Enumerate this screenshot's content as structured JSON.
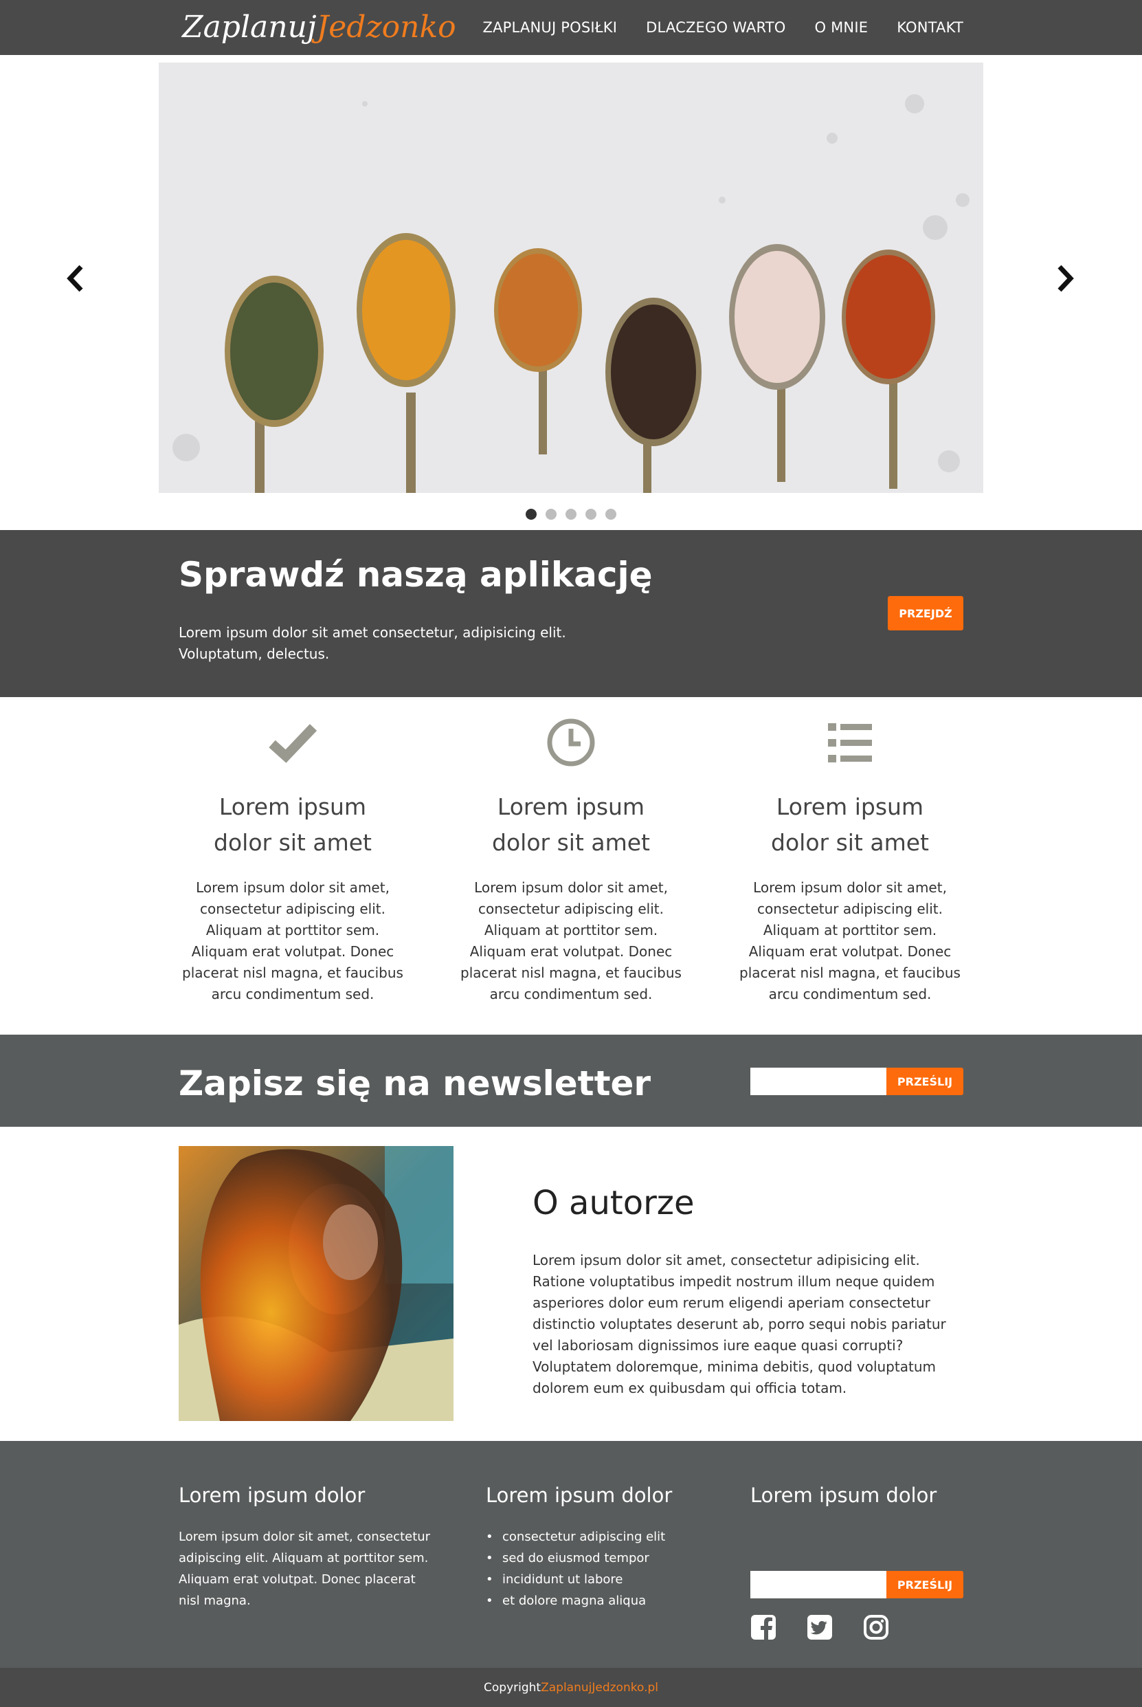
{
  "brand": {
    "logo_part1": "Zaplanuj",
    "logo_part2": "Jedzonko",
    "accent_color": "#fe6b0c",
    "header_color": "#4a4a4a"
  },
  "nav": {
    "items": [
      {
        "label": "ZAPLANUJ POSIŁKI"
      },
      {
        "label": "DLACZEGO WARTO"
      },
      {
        "label": "O MNIE"
      },
      {
        "label": "KONTAKT"
      }
    ]
  },
  "slider": {
    "prev_icon": "chevron-left-icon",
    "next_icon": "chevron-right-icon",
    "dots_count": 5,
    "active_dot": 0
  },
  "app_banner": {
    "title": "Sprawdź naszą aplikację",
    "text": "Lorem ipsum dolor sit amet consectetur, adipisicing elit. Voluptatum, delectus.",
    "button": "PRZEJDŹ"
  },
  "features": [
    {
      "icon": "check-icon",
      "title_line1": "Lorem ipsum",
      "title_line2": "dolor sit amet",
      "text": "Lorem ipsum dolor sit amet, consectetur adipiscing elit. Aliquam at porttitor sem. Aliquam erat volutpat. Donec placerat nisl magna, et faucibus arcu condimentum sed."
    },
    {
      "icon": "clock-icon",
      "title_line1": "Lorem ipsum",
      "title_line2": "dolor sit amet",
      "text": "Lorem ipsum dolor sit amet, consectetur adipiscing elit. Aliquam at porttitor sem. Aliquam erat volutpat. Donec placerat nisl magna, et faucibus arcu condimentum sed."
    },
    {
      "icon": "list-icon",
      "title_line1": "Lorem ipsum",
      "title_line2": "dolor sit amet",
      "text": "Lorem ipsum dolor sit amet, consectetur adipiscing elit. Aliquam at porttitor sem. Aliquam erat volutpat. Donec placerat nisl magna, et faucibus arcu condimentum sed."
    }
  ],
  "newsletter": {
    "title": "Zapisz się na newsletter",
    "input_value": "",
    "button": "PRZEŚLIJ"
  },
  "about": {
    "title": "O autorze",
    "text": "Lorem ipsum dolor sit amet, consectetur adipisicing elit. Ratione voluptatibus impedit nostrum illum neque quidem asperiores dolor eum rerum eligendi aperiam consectetur distinctio voluptates deserunt ab, porro sequi nobis pariatur vel laboriosam dignissimos iure eaque quasi corrupti? Voluptatem doloremque, minima debitis, quod voluptatum dolorem eum ex quibusdam qui officia totam."
  },
  "footer": {
    "col1": {
      "title": "Lorem ipsum dolor",
      "text": "Lorem ipsum dolor sit amet, consectetur adipiscing elit. Aliquam at porttitor sem. Aliquam erat volutpat. Donec placerat nisl magna."
    },
    "col2": {
      "title": "Lorem ipsum dolor",
      "items": [
        "consectetur adipiscing elit",
        "sed do eiusmod tempor",
        "incididunt ut labore",
        "et dolore magna aliqua"
      ]
    },
    "col3": {
      "title": "Lorem ipsum dolor",
      "input_value": "",
      "button": "PRZEŚLIJ",
      "social": [
        "facebook-icon",
        "twitter-icon",
        "instagram-icon"
      ]
    }
  },
  "copyright": {
    "prefix": "Copyright",
    "link": "ZaplanujJedzonko.pl"
  }
}
